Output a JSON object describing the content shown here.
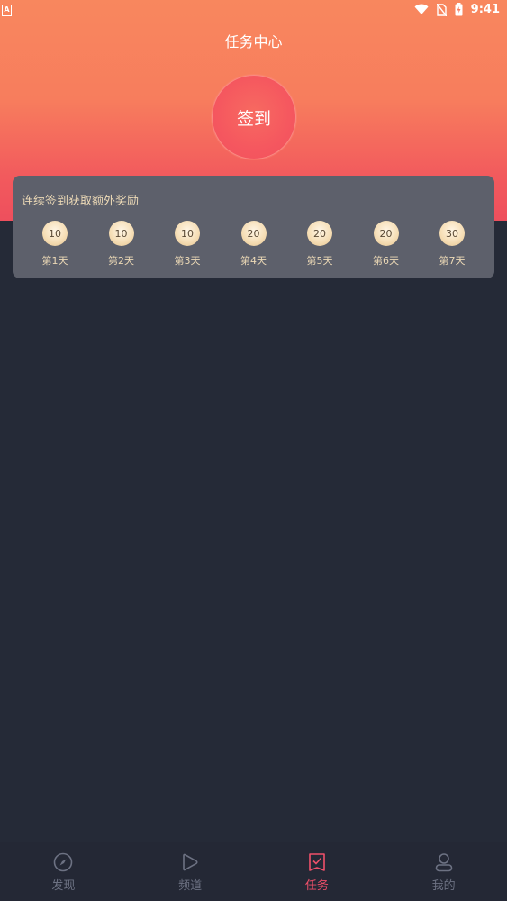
{
  "status_bar": {
    "left_icon_name": "notification-a-icon",
    "left_icon_glyph": "A",
    "time": "9:41",
    "icons": [
      "wifi-icon",
      "no-sim-icon",
      "battery-icon"
    ]
  },
  "header": {
    "title": "任务中心",
    "checkin_label": "签到"
  },
  "reward": {
    "title": "连续签到获取额外奖励",
    "days": [
      {
        "points": "10",
        "label": "第1天"
      },
      {
        "points": "10",
        "label": "第2天"
      },
      {
        "points": "10",
        "label": "第3天"
      },
      {
        "points": "20",
        "label": "第4天"
      },
      {
        "points": "20",
        "label": "第5天"
      },
      {
        "points": "20",
        "label": "第6天"
      },
      {
        "points": "30",
        "label": "第7天"
      }
    ]
  },
  "tabs": [
    {
      "label": "发现",
      "icon": "compass-icon",
      "active": false
    },
    {
      "label": "频道",
      "icon": "play-icon",
      "active": false
    },
    {
      "label": "任务",
      "icon": "task-check-icon",
      "active": true
    },
    {
      "label": "我的",
      "icon": "user-icon",
      "active": false
    }
  ],
  "colors": {
    "accent": "#f0506a",
    "background": "#252a37",
    "gold_text": "#ecd9b6"
  }
}
